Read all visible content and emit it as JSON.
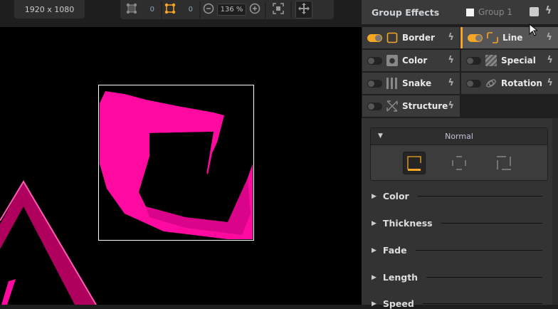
{
  "toolbar": {
    "resolution": "1920 x 1080",
    "count_a": "0",
    "count_b": "0",
    "zoom": "136 %"
  },
  "panel": {
    "title": "Group Effects",
    "group_name": "Group 1",
    "effects": [
      {
        "label": "Border",
        "on": true
      },
      {
        "label": "Line",
        "on": true,
        "active": true
      },
      {
        "label": "Color",
        "on": false
      },
      {
        "label": "Special",
        "on": false
      },
      {
        "label": "Snake",
        "on": false
      },
      {
        "label": "Rotation",
        "on": false
      },
      {
        "label": "Structure",
        "on": false
      }
    ],
    "mode": "Normal",
    "sections": [
      "Color",
      "Thickness",
      "Fade",
      "Length",
      "Speed"
    ]
  },
  "colors": {
    "accent": "#f5a623",
    "pink": "#ff0aa0"
  }
}
